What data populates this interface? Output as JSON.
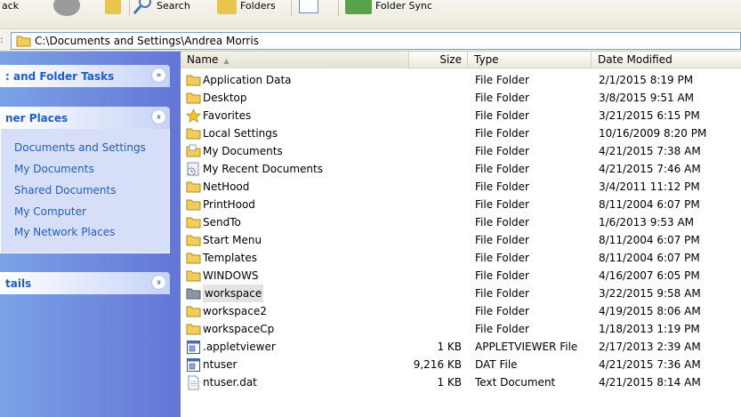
{
  "toolbar": {
    "back_label": "ack",
    "search_label": "Search",
    "folders_label": "Folders",
    "folder_sync_label": "Folder Sync"
  },
  "address": {
    "path": "C:\\Documents and Settings\\Andrea Morris"
  },
  "taskpane": {
    "file_folder_tasks": ": and Folder Tasks",
    "other_places": "ner Places",
    "details": "tails",
    "links": [
      "Documents and Settings",
      "My Documents",
      "Shared Documents",
      "My Computer",
      "My Network Places"
    ]
  },
  "columns": {
    "name": "Name",
    "size": "Size",
    "type": "Type",
    "date": "Date Modified"
  },
  "files": [
    {
      "name": "Application Data",
      "size": "",
      "type": "File Folder",
      "date": "2/1/2015 8:19 PM",
      "icon": "folder-icon"
    },
    {
      "name": "Desktop",
      "size": "",
      "type": "File Folder",
      "date": "3/8/2015 9:51 AM",
      "icon": "folder-icon"
    },
    {
      "name": "Favorites",
      "size": "",
      "type": "File Folder",
      "date": "3/21/2015 6:15 PM",
      "icon": "favorites-star-icon"
    },
    {
      "name": "Local Settings",
      "size": "",
      "type": "File Folder",
      "date": "10/16/2009 8:20 PM",
      "icon": "folder-icon"
    },
    {
      "name": "My Documents",
      "size": "",
      "type": "File Folder",
      "date": "4/21/2015 7:38 AM",
      "icon": "my-documents-folder-icon"
    },
    {
      "name": "My Recent Documents",
      "size": "",
      "type": "File Folder",
      "date": "4/21/2015 7:46 AM",
      "icon": "recent-documents-icon"
    },
    {
      "name": "NetHood",
      "size": "",
      "type": "File Folder",
      "date": "3/4/2011 11:12 PM",
      "icon": "folder-icon"
    },
    {
      "name": "PrintHood",
      "size": "",
      "type": "File Folder",
      "date": "8/11/2004 6:07 PM",
      "icon": "folder-icon"
    },
    {
      "name": "SendTo",
      "size": "",
      "type": "File Folder",
      "date": "1/6/2013 9:53 AM",
      "icon": "folder-icon"
    },
    {
      "name": "Start Menu",
      "size": "",
      "type": "File Folder",
      "date": "8/11/2004 6:07 PM",
      "icon": "folder-icon"
    },
    {
      "name": "Templates",
      "size": "",
      "type": "File Folder",
      "date": "8/11/2004 6:07 PM",
      "icon": "folder-icon"
    },
    {
      "name": "WINDOWS",
      "size": "",
      "type": "File Folder",
      "date": "4/16/2007 6:05 PM",
      "icon": "folder-icon"
    },
    {
      "name": "workspace",
      "size": "",
      "type": "File Folder",
      "date": "3/22/2015 9:58 AM",
      "icon": "folder-gray-icon",
      "selected": true
    },
    {
      "name": "workspace2",
      "size": "",
      "type": "File Folder",
      "date": "4/19/2015 8:06 AM",
      "icon": "folder-icon"
    },
    {
      "name": "workspaceCp",
      "size": "",
      "type": "File Folder",
      "date": "1/18/2013 1:19 PM",
      "icon": "folder-icon"
    },
    {
      "name": ".appletviewer",
      "size": "1 KB",
      "type": "APPLETVIEWER File",
      "date": "2/17/2013 2:39 AM",
      "icon": "system-file-icon"
    },
    {
      "name": "ntuser",
      "size": "9,216 KB",
      "type": "DAT File",
      "date": "4/21/2015 7:36 AM",
      "icon": "system-file-icon"
    },
    {
      "name": "ntuser.dat",
      "size": "1 KB",
      "type": "Text Document",
      "date": "4/21/2015 8:14 AM",
      "icon": "text-document-icon"
    }
  ],
  "colors": {
    "taskpane_gradient_start": "#7ba2e7",
    "taskpane_gradient_end": "#6375d6",
    "link_blue": "#215dc6",
    "folder_yellow": "#f3cd5a"
  }
}
